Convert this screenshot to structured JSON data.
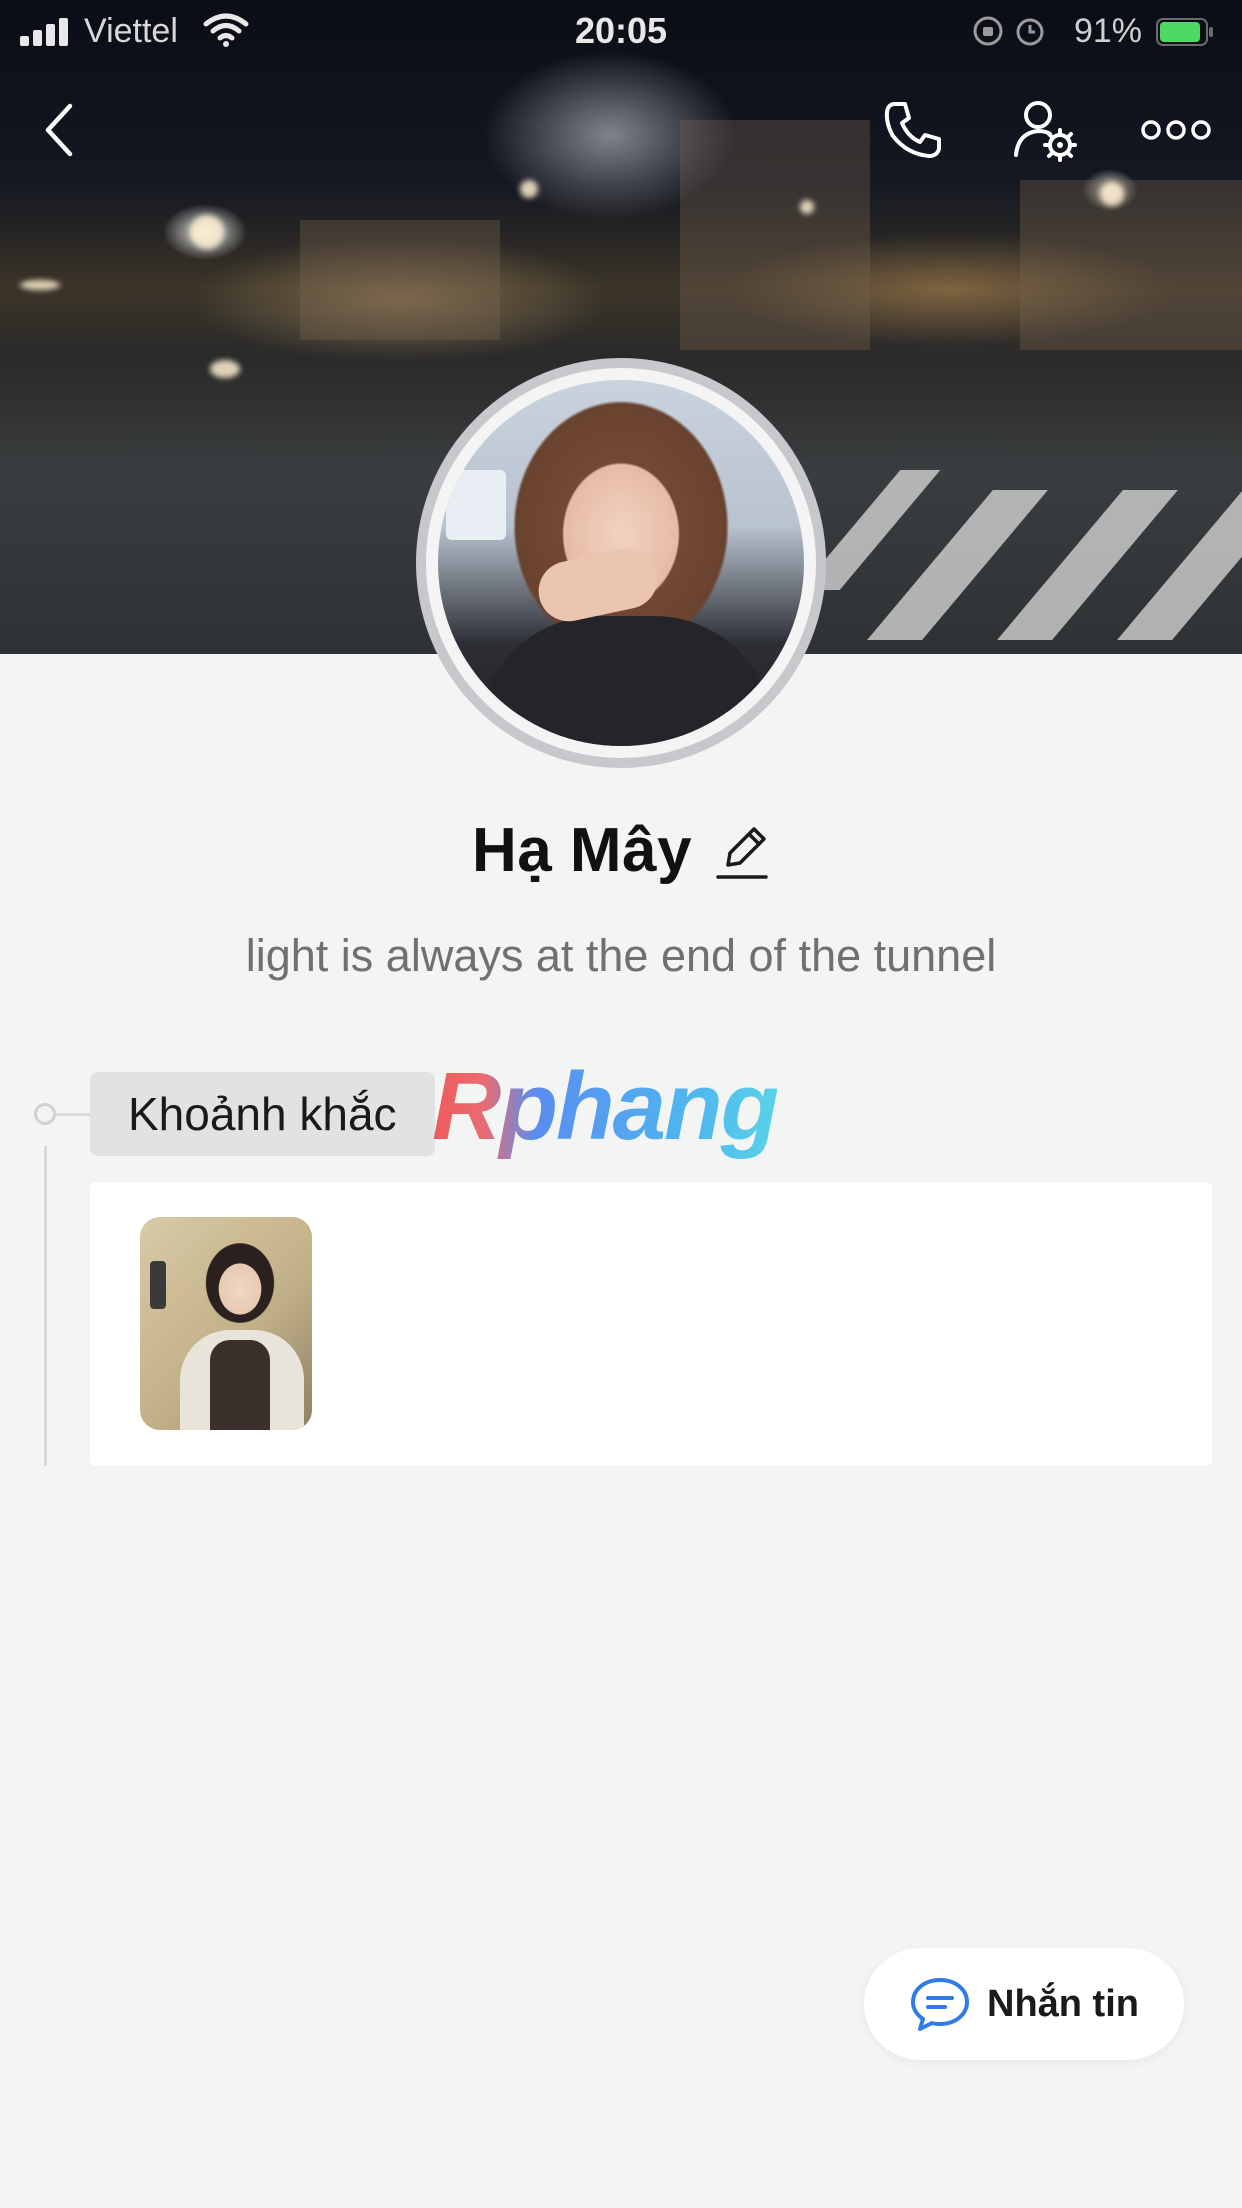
{
  "status_bar": {
    "carrier": "Viettel",
    "time": "20:05",
    "battery_percent": "91%",
    "icons": [
      "signal-icon",
      "wifi-icon",
      "orientation-lock-icon",
      "alarm-icon",
      "battery-icon"
    ]
  },
  "nav": {
    "icons": [
      "back-icon",
      "phone-icon",
      "profile-settings-icon",
      "more-icon"
    ]
  },
  "profile": {
    "name": "Hạ Mây",
    "bio": "light is always at the end of the tunnel"
  },
  "moments": {
    "title": "Khoảnh khắc",
    "item_count": 1
  },
  "watermark": "Rphang",
  "actions": {
    "message_label": "Nhắn tin"
  },
  "colors": {
    "accent_blue": "#2f7bea",
    "text_primary": "#111111",
    "text_secondary": "#6f7072",
    "background": "#f3f4f4",
    "battery_green": "#4cd964"
  }
}
